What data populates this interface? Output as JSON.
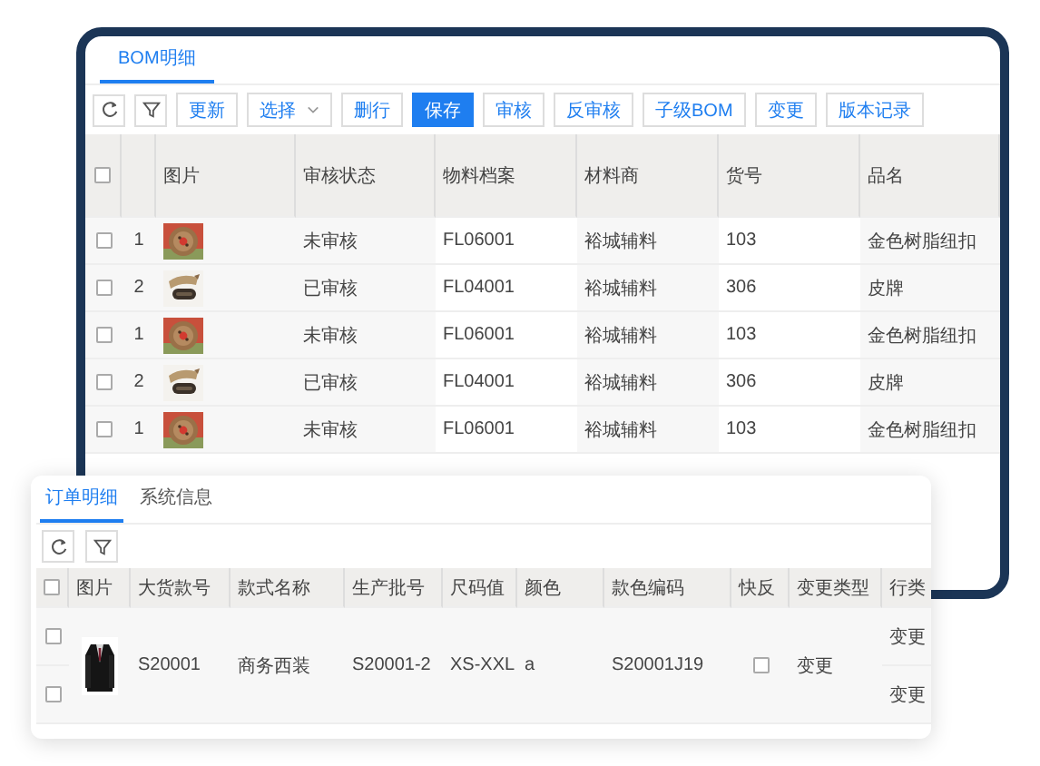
{
  "bom_window": {
    "tabs": [
      {
        "label": "BOM明细",
        "selected": true
      }
    ],
    "toolbar": [
      {
        "label": "更新",
        "primary": false,
        "dropdown": false
      },
      {
        "label": "选择",
        "primary": false,
        "dropdown": true
      },
      {
        "label": "删行",
        "primary": false,
        "dropdown": false
      },
      {
        "label": "保存",
        "primary": true,
        "dropdown": false
      },
      {
        "label": "审核",
        "primary": false,
        "dropdown": false
      },
      {
        "label": "反审核",
        "primary": false,
        "dropdown": false
      },
      {
        "label": "子级BOM",
        "primary": false,
        "dropdown": false
      },
      {
        "label": "变更",
        "primary": false,
        "dropdown": false
      },
      {
        "label": "版本记录",
        "primary": false,
        "dropdown": false
      }
    ],
    "table": {
      "header_checked": false,
      "columns": [
        "图片",
        "审核状态",
        "物料档案",
        "材料商",
        "货号",
        "品名"
      ],
      "rows": [
        {
          "checked": false,
          "seq": "1",
          "status": "未审核",
          "material": "FL06001",
          "supplier": "裕城辅料",
          "item_no": "103",
          "name": "金色树脂纽扣"
        },
        {
          "checked": false,
          "seq": "2",
          "status": "已审核",
          "material": "FL04001",
          "supplier": "裕城辅料",
          "item_no": "306",
          "name": "皮牌"
        },
        {
          "checked": false,
          "seq": "1",
          "status": "未审核",
          "material": "FL06001",
          "supplier": "裕城辅料",
          "item_no": "103",
          "name": "金色树脂纽扣"
        },
        {
          "checked": false,
          "seq": "2",
          "status": "已审核",
          "material": "FL04001",
          "supplier": "裕城辅料",
          "item_no": "306",
          "name": "皮牌"
        },
        {
          "checked": false,
          "seq": "1",
          "status": "未审核",
          "material": "FL06001",
          "supplier": "裕城辅料",
          "item_no": "103",
          "name": "金色树脂纽扣"
        }
      ]
    }
  },
  "order_window": {
    "tabs": [
      {
        "label": "订单明细",
        "selected": true
      },
      {
        "label": "系统信息",
        "selected": false
      }
    ],
    "table": {
      "header_checked": false,
      "columns": [
        "图片",
        "大货款号",
        "款式名称",
        "生产批号",
        "尺码值",
        "颜色",
        "款色编码",
        "快反",
        "变更类型",
        "行类"
      ],
      "rows": [
        {
          "sku": "S20001",
          "style_name": "商务西装",
          "batch": "S20001-2",
          "sizes": "XS-XXL",
          "colour_name": "a",
          "style_color_code": "S20001J19",
          "quick_response": false,
          "change_type": "变更",
          "sub_rows": [
            {
              "checked": false,
              "line_type": "变更"
            },
            {
              "checked": false,
              "line_type": "变更"
            }
          ]
        }
      ]
    }
  }
}
